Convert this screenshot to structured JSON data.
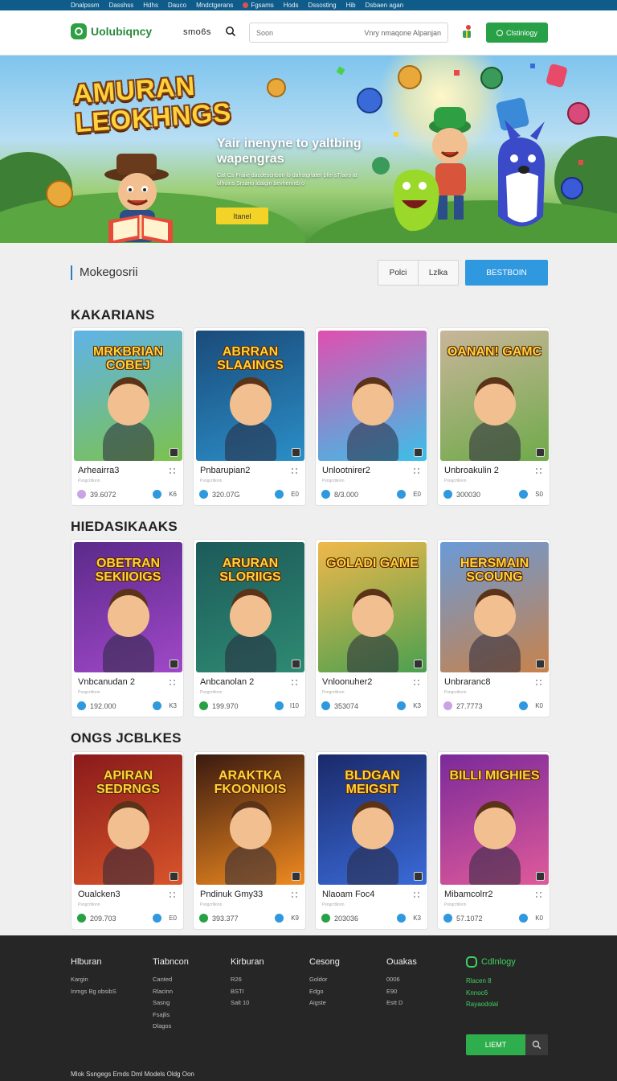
{
  "top_strip": [
    "Dnalpssm",
    "Dasshss",
    "Hdhs",
    "Dauco",
    "Mndctgerans",
    "Fgsams",
    "Hods",
    "Dssosting",
    "Hib",
    "Dsbaen agan"
  ],
  "header": {
    "logo": "Uolubiqncy",
    "nav": "smo6s",
    "search_placeholder": "Soon",
    "search_right": "Vnry nmaqone Alpanjan",
    "login": "Clstinlogy"
  },
  "hero": {
    "title": "AMURAN LEOKHNGS",
    "heading": "Yair inenyne to yaltbing wapengras",
    "subtext": "Cat Cs Fraiie dacdescnbon lo dahstgrlater bfei sTfairs at olhoins Srsano ldaigin bevhenntb o",
    "button": "Itanel"
  },
  "filter": {
    "label": "Mokegosrii",
    "seg1": "Polci",
    "seg2": "Lzlka",
    "primary": "BESTBOIN"
  },
  "sections": [
    {
      "title": "KAKARIANS",
      "cards": [
        {
          "name": "Arheairra3",
          "art": "MRKBRIAN COBEJ",
          "meta": "Psngcrtilonn",
          "stat": "39.6072",
          "stat2": "K6",
          "color1": "#5fb3e8",
          "color2": "#7cc24c",
          "ico": "#c9a3e6"
        },
        {
          "name": "Pnbarupian2",
          "art": "ABRRAN SLAAINGS",
          "meta": "Psngcrtilonn",
          "stat": "320.07G",
          "stat2": "E0",
          "color1": "#1a4b7a",
          "color2": "#2b8ec7",
          "ico": "#2f98de"
        },
        {
          "name": "Unlootnirer2",
          "art": "",
          "meta": "Psngcrtilonn",
          "stat": "8/3.000",
          "stat2": "E0",
          "color1": "#e04fb0",
          "color2": "#3ac0e8",
          "ico": "#2f98de"
        },
        {
          "name": "Unbroakulin 2",
          "art": "OANAN! GAMC",
          "meta": "Psngcrtilonn",
          "stat": "300030",
          "stat2": "S0",
          "color1": "#c9b59a",
          "color2": "#6faa4a",
          "ico": "#2f98de"
        }
      ]
    },
    {
      "title": "HIEDASIKAAKS",
      "cards": [
        {
          "name": "Vnbcanudan 2",
          "art": "OBETRAN SEKIIOIGS",
          "meta": "Psngcrtilonn",
          "stat": "192.000",
          "stat2": "K3",
          "color1": "#5b2a8a",
          "color2": "#a048c8",
          "ico": "#2f98de"
        },
        {
          "name": "Anbcanolan 2",
          "art": "ARURAN SLORIIGS",
          "meta": "Psngcrtilonn",
          "stat": "199.970",
          "stat2": "I10",
          "color1": "#1d5a5a",
          "color2": "#2e8a72",
          "ico": "#27a046"
        },
        {
          "name": "Vnloonuher2",
          "art": "GOLADI GAME",
          "meta": "Psngcrtilonn",
          "stat": "353074",
          "stat2": "K3",
          "color1": "#f0b84a",
          "color2": "#4aa050",
          "ico": "#2f98de"
        },
        {
          "name": "Unbraranc8",
          "art": "HERSMAIN SCOUNG",
          "meta": "Psngcrtilonn",
          "stat": "27.7773",
          "stat2": "K0",
          "color1": "#6a9ad8",
          "color2": "#c8824a",
          "ico": "#c9a3e6"
        }
      ]
    },
    {
      "title": "ONGS JCBLKES",
      "cards": [
        {
          "name": "Oualcken3",
          "art": "APIRAN SEDRNGS",
          "meta": "Psngcrtilonn",
          "stat": "209.703",
          "stat2": "E0",
          "color1": "#8a1a1a",
          "color2": "#d8542a",
          "ico": "#27a046"
        },
        {
          "name": "Pndinuk Gmy33",
          "art": "ARAKTKA FKOONIOIS",
          "meta": "Psngcrtilonn",
          "stat": "393.377",
          "stat2": "K9",
          "color1": "#3a1a10",
          "color2": "#f08a20",
          "ico": "#27a046"
        },
        {
          "name": "Nlaoam Foc4",
          "art": "BLDGAN MEIGSIT",
          "meta": "Psngcrtilonn",
          "stat": "203036",
          "stat2": "K3",
          "color1": "#1a2a6a",
          "color2": "#3a6ad8",
          "ico": "#27a046"
        },
        {
          "name": "Mibamcolrr2",
          "art": "BILLI MIGHIES",
          "meta": "Psngcrtilonn",
          "stat": "57.1072",
          "stat2": "K0",
          "color1": "#7a2a9a",
          "color2": "#e05a9a",
          "ico": "#2f98de"
        }
      ]
    }
  ],
  "footer": {
    "cols": [
      {
        "head": "Hlburan",
        "items": [
          "Kargin",
          "Inmgs Bg obsibS"
        ]
      },
      {
        "head": "Tiabncon",
        "items": [
          "Canted",
          "Rlacinn",
          "Sasng",
          "Fsajlis",
          "Dlagos"
        ]
      },
      {
        "head": "Kirburan",
        "items": [
          "R26",
          "BSTI",
          "Salt 10"
        ]
      },
      {
        "head": "Cesong",
        "items": [
          "Goldor",
          "Edgo",
          "Aigste"
        ]
      },
      {
        "head": "Ouakas",
        "items": [
          "0006",
          "E90",
          "Estt D"
        ]
      }
    ],
    "logo": "Cdlnlogy",
    "green_lines": [
      "Rlacen 8",
      "Knnoc6",
      "Rayaodolal"
    ],
    "subscribe": "LIEMT",
    "bottom": "Mlok Ssngegs   Emds   Dml   Models   Oldg   Oon"
  }
}
